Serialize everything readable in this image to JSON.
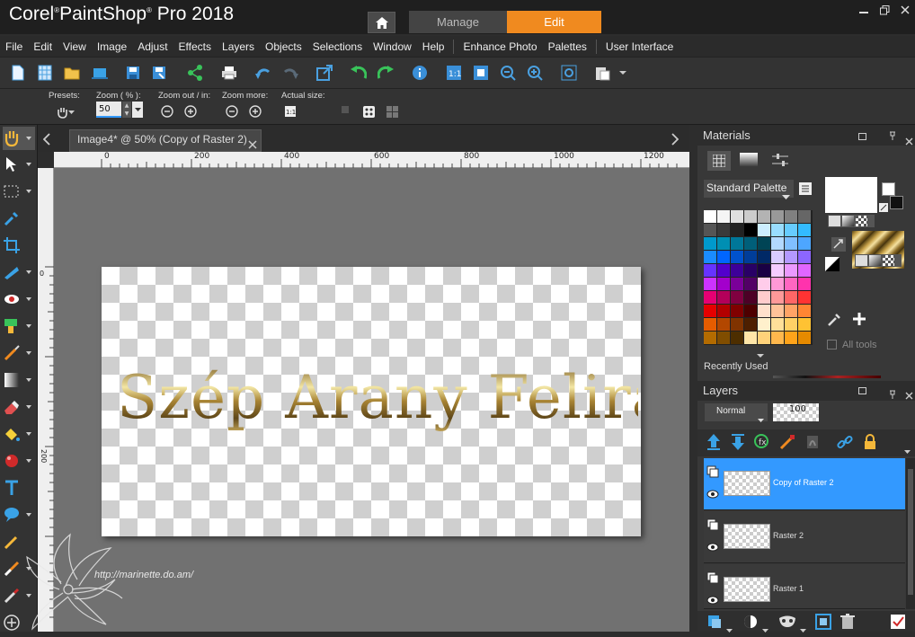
{
  "app": {
    "title": "Corel",
    "title2": "PaintShop",
    "title3": "Pro 2018"
  },
  "workspace_tabs": {
    "manage": "Manage",
    "edit": "Edit"
  },
  "menu": [
    "File",
    "Edit",
    "View",
    "Image",
    "Adjust",
    "Effects",
    "Layers",
    "Objects",
    "Selections",
    "Window",
    "Help",
    "Enhance Photo",
    "Palettes",
    "User Interface"
  ],
  "options": {
    "presets_label": "Presets:",
    "zoom_label": "Zoom ( % ):",
    "zoom_value": "50",
    "zoomout_label": "Zoom out / in:",
    "zoommore_label": "Zoom more:",
    "actual_label": "Actual size:"
  },
  "document": {
    "tab_label": "Image4* @  50% (Copy of Raster 2)",
    "text": "Szép Arany Felirat",
    "watermark_url": "http://marinette.do.am/"
  },
  "rulers": {
    "h": [
      "0",
      "200",
      "400",
      "600",
      "800",
      "1000",
      "1200"
    ],
    "v": [
      "0",
      "200"
    ]
  },
  "materials": {
    "title": "Materials",
    "palette": "Standard Palette",
    "all_tools": "All tools",
    "recently_used": "Recently Used"
  },
  "layers": {
    "title": "Layers",
    "blend_mode": "Normal",
    "opacity": "100",
    "items": [
      {
        "name": "Copy of Raster 2",
        "selected": true
      },
      {
        "name": "Raster 2",
        "selected": false
      },
      {
        "name": "Raster 1",
        "selected": false
      }
    ]
  },
  "colors": {
    "accent": "#f08a1f",
    "selection": "#3399ff"
  }
}
